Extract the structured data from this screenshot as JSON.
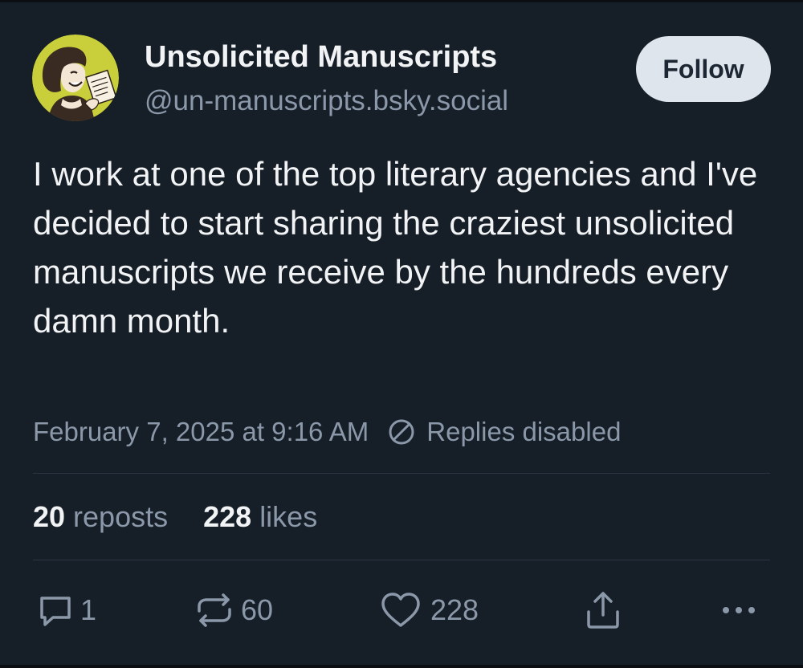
{
  "author": {
    "display_name": "Unsolicited Manuscripts",
    "handle": "@un-manuscripts.bsky.social"
  },
  "follow_button": {
    "label": "Follow"
  },
  "post": {
    "text": "I work at one of the top literary agencies and I've decided to start sharing the craziest unsolicited manuscripts we receive by the hundreds every damn month.",
    "timestamp": "February 7, 2025 at 9:16 AM",
    "replies_status": "Replies disabled"
  },
  "stats": {
    "reposts_count": "20",
    "reposts_label": "reposts",
    "likes_count": "228",
    "likes_label": "likes"
  },
  "actions": {
    "reply_count": "1",
    "repost_count": "60",
    "like_count": "228",
    "share_icon": "share-icon",
    "more_icon": "more-icon"
  },
  "colors": {
    "background": "#161e27",
    "text_primary": "#f1f3f5",
    "text_secondary": "#8b98a9",
    "follow_button_bg": "#dfe5ec",
    "avatar_bg": "#c9cf3a"
  }
}
